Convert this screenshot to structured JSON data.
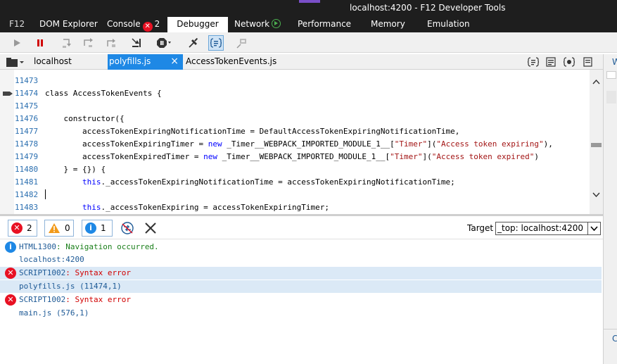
{
  "window": {
    "title": "localhost:4200 - F12 Developer Tools"
  },
  "tabs": [
    {
      "label": "F12"
    },
    {
      "label": "DOM Explorer"
    },
    {
      "label": "Console",
      "badge": "2"
    },
    {
      "label": "Debugger"
    },
    {
      "label": "Network"
    },
    {
      "label": "Performance"
    },
    {
      "label": "Memory"
    },
    {
      "label": "Emulation"
    }
  ],
  "toolbar": {
    "icons": [
      "continue-icon",
      "break-icon",
      "step-into-icon",
      "step-over-icon",
      "step-out-icon",
      "break-on-new-worker-icon",
      "exceptions-icon",
      "pretty-print-icon",
      "disconnect-icon",
      "breakpoint-icon"
    ]
  },
  "file_tabs": [
    {
      "label": "localhost"
    },
    {
      "label": "polyfills.js",
      "close": "×"
    },
    {
      "label": "AccessTokenEvents.js"
    }
  ],
  "code": [
    {
      "ln": "11473",
      "text": ""
    },
    {
      "ln": "11474",
      "text": "class AccessTokenEvents {"
    },
    {
      "ln": "11475",
      "text": ""
    },
    {
      "ln": "11476",
      "text": "    constructor({"
    },
    {
      "ln": "11477",
      "text": "        accessTokenExpiringNotificationTime = DefaultAccessTokenExpiringNotificationTime,"
    },
    {
      "ln": "11478",
      "pre": "        accessTokenExpiringTimer = ",
      "kw": "new",
      "mid": " _Timer__WEBPACK_IMPORTED_MODULE_1__[",
      "s1": "\"Timer\"",
      "mid2": "](",
      "s2": "\"Access token expiring\"",
      "post": "),"
    },
    {
      "ln": "11479",
      "pre": "        accessTokenExpiredTimer = ",
      "kw": "new",
      "mid": " _Timer__WEBPACK_IMPORTED_MODULE_1__[",
      "s1": "\"Timer\"",
      "mid2": "](",
      "s2": "\"Access token expired\"",
      "post": ")"
    },
    {
      "ln": "11480",
      "text": "    } = {}) {"
    },
    {
      "ln": "11481",
      "pre": "        ",
      "kw": "this",
      "post": "._accessTokenExpiringNotificationTime = accessTokenExpiringNotificationTime;"
    },
    {
      "ln": "11482",
      "text": ""
    },
    {
      "ln": "11483",
      "pre": "        ",
      "kw": "this",
      "post": "._accessTokenExpiring = accessTokenExpiringTimer;"
    }
  ],
  "console_toolbar": {
    "errors": "2",
    "warnings": "0",
    "info": "1",
    "target_label": "Target",
    "target_value": "_top: localhost:4200"
  },
  "messages": [
    {
      "code": "HTML1300",
      "text": ": Navigation occurred.",
      "level": "info"
    },
    {
      "link": "localhost:4200"
    },
    {
      "code": "SCRIPT1002",
      "text": ": Syntax error",
      "level": "error"
    },
    {
      "link": "polyfills.js (11474,1)"
    },
    {
      "code": "SCRIPT1002",
      "text": ": Syntax error",
      "level": "error"
    },
    {
      "link": "main.js (576,1)"
    }
  ],
  "right_pane": {
    "top_char": "W",
    "bottom_char": "C"
  },
  "colors": {
    "accent": "#1e88e5",
    "error": "#e81123",
    "title_bg": "#1e1e1e"
  }
}
